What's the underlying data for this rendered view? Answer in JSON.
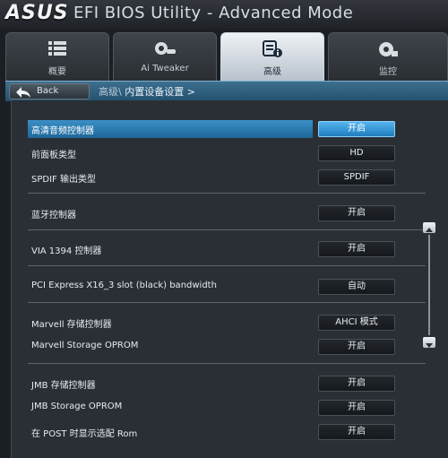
{
  "title": {
    "logo": "ASUS",
    "app_title": "EFI BIOS Utility - Advanced Mode"
  },
  "tabs": [
    {
      "label": "概要",
      "icon": "list-icon"
    },
    {
      "label": "Ai Tweaker",
      "icon": "tweaker-icon"
    },
    {
      "label": "高级",
      "icon": "advanced-icon",
      "active": true
    },
    {
      "label": "监控",
      "icon": "monitor-icon"
    }
  ],
  "nav": {
    "back_label": "Back",
    "breadcrumb_parent": "高级\\",
    "breadcrumb_current": "内置设备设置 >"
  },
  "settings": [
    {
      "label": "高清音频控制器",
      "value": "开启",
      "selected": true
    },
    {
      "label": "前面板类型",
      "value": "HD"
    },
    {
      "label": "SPDIF 输出类型",
      "value": "SPDIF"
    },
    {
      "label": "蓝牙控制器",
      "value": "开启"
    },
    {
      "label": "VIA 1394 控制器",
      "value": "开启"
    },
    {
      "label": "PCI Express X16_3 slot (black) bandwidth",
      "value": "自动"
    },
    {
      "label": "Marvell 存储控制器",
      "value": "AHCI 模式"
    },
    {
      "label": "Marvell Storage OPROM",
      "value": "开启"
    },
    {
      "label": "JMB 存储控制器",
      "value": "开启"
    },
    {
      "label": "JMB Storage OPROM",
      "value": "开启"
    },
    {
      "label": "在 POST 时显示选配 Rom",
      "value": "开启"
    }
  ],
  "colors": {
    "accent": "#1f7dc0",
    "highlight": "#2f80b5",
    "background": "#2a2f35"
  }
}
